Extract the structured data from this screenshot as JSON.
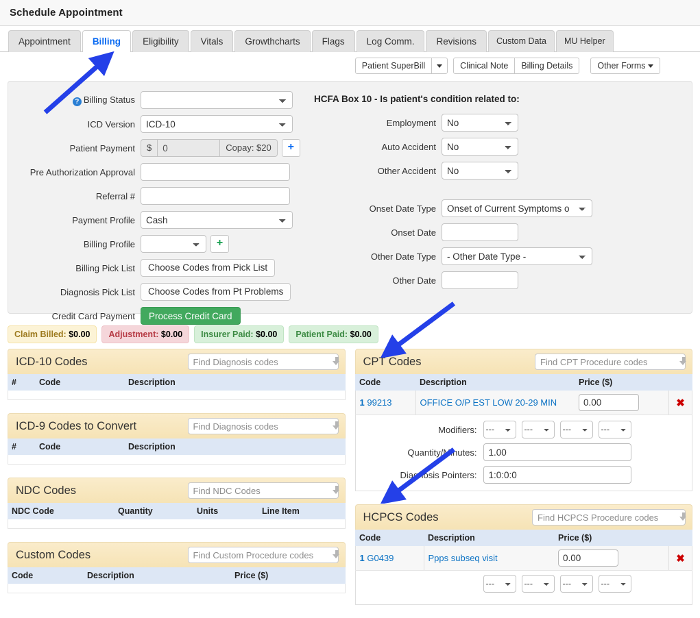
{
  "window": {
    "title": "Schedule Appointment"
  },
  "tabs": [
    {
      "label": "Appointment",
      "active": false
    },
    {
      "label": "Billing",
      "active": true
    },
    {
      "label": "Eligibility",
      "active": false
    },
    {
      "label": "Vitals",
      "active": false
    },
    {
      "label": "Growthcharts",
      "active": false
    },
    {
      "label": "Flags",
      "active": false
    },
    {
      "label": "Log Comm.",
      "active": false
    },
    {
      "label": "Revisions",
      "active": false
    },
    {
      "label": "Custom Data",
      "active": false
    },
    {
      "label": "MU Helper",
      "active": false
    }
  ],
  "actions": {
    "patient_superbill": "Patient SuperBill",
    "superbill_caret": "caret-down-icon",
    "clinical_note": "Clinical Note",
    "billing_details": "Billing Details",
    "other_forms": "Other Forms"
  },
  "billing_form": {
    "billing_status": {
      "label": "Billing Status",
      "help": "?",
      "value": ""
    },
    "icd_version": {
      "label": "ICD Version",
      "value": "ICD-10"
    },
    "patient_payment": {
      "label": "Patient Payment",
      "currency": "$",
      "value": "0",
      "copay": "Copay: $20",
      "add": "+"
    },
    "pre_auth": {
      "label": "Pre Authorization Approval",
      "value": ""
    },
    "referral": {
      "label": "Referral #",
      "value": ""
    },
    "payment_profile": {
      "label": "Payment Profile",
      "value": "Cash"
    },
    "billing_profile": {
      "label": "Billing Profile",
      "value": "",
      "add": "+"
    },
    "billing_pick_list": {
      "label": "Billing Pick List",
      "button": "Choose Codes from Pick List"
    },
    "diagnosis_pick_list": {
      "label": "Diagnosis Pick List",
      "button": "Choose Codes from Pt Problems"
    },
    "credit_card": {
      "label": "Credit Card Payment",
      "button": "Process Credit Card"
    }
  },
  "hcfa": {
    "heading": "HCFA Box 10 - Is patient's condition related to:",
    "employment": {
      "label": "Employment",
      "value": "No"
    },
    "auto_accident": {
      "label": "Auto Accident",
      "value": "No"
    },
    "other_accident": {
      "label": "Other Accident",
      "value": "No"
    },
    "onset_date_type": {
      "label": "Onset Date Type",
      "value": "Onset of Current Symptoms o"
    },
    "onset_date": {
      "label": "Onset Date",
      "value": ""
    },
    "other_date_type": {
      "label": "Other Date Type",
      "value": "- Other Date Type -"
    },
    "other_date": {
      "label": "Other Date",
      "value": ""
    }
  },
  "badges": [
    {
      "label": "Claim Billed:",
      "amount": "$0.00",
      "style": "warn"
    },
    {
      "label": "Adjustment:",
      "amount": "$0.00",
      "style": "danger"
    },
    {
      "label": "Insurer Paid:",
      "amount": "$0.00",
      "style": "ok"
    },
    {
      "label": "Patient Paid:",
      "amount": "$0.00",
      "style": "ok"
    }
  ],
  "panels": {
    "icd10": {
      "title": "ICD-10 Codes",
      "search_placeholder": "Find Diagnosis codes",
      "columns": [
        "#",
        "Code",
        "Description"
      ],
      "rows": []
    },
    "icd9": {
      "title": "ICD-9 Codes to Convert",
      "search_placeholder": "Find Diagnosis codes",
      "columns": [
        "#",
        "Code",
        "Description"
      ],
      "rows": []
    },
    "ndc": {
      "title": "NDC Codes",
      "search_placeholder": "Find NDC Codes",
      "columns": [
        "NDC Code",
        "Quantity",
        "Units",
        "Line Item"
      ],
      "rows": []
    },
    "custom": {
      "title": "Custom Codes",
      "search_placeholder": "Find Custom Procedure codes",
      "columns": [
        "Code",
        "Description",
        "Price ($)"
      ],
      "rows": []
    },
    "cpt": {
      "title": "CPT Codes",
      "search_placeholder": "Find CPT Procedure codes",
      "columns": [
        "Code",
        "Description",
        "Price ($)"
      ],
      "row": {
        "num": "1",
        "code": "99213",
        "description": "OFFICE O/P EST LOW 20-29 MIN",
        "price": "0.00",
        "delete": "✖"
      },
      "detail": {
        "modifiers_label": "Modifiers:",
        "modifiers": [
          "---",
          "---",
          "---",
          "---"
        ],
        "quantity_label": "Quantity/Minutes:",
        "quantity": "1.00",
        "pointers_label": "Diagnosis Pointers:",
        "pointers": "1:0:0:0"
      }
    },
    "hcpcs": {
      "title": "HCPCS Codes",
      "search_placeholder": "Find HCPCS Procedure codes",
      "columns": [
        "Code",
        "Description",
        "Price ($)"
      ],
      "row": {
        "num": "1",
        "code": "G0439",
        "description": "Ppps subseq visit",
        "price": "0.00",
        "delete": "✖"
      },
      "detail": {
        "modifiers": [
          "---",
          "---",
          "---",
          "---"
        ]
      }
    }
  },
  "annotations": {
    "color": "#2440e8",
    "arrows": [
      {
        "name": "arrow-to-billing-tab",
        "target": "Billing tab"
      },
      {
        "name": "arrow-to-cpt-codes",
        "target": "CPT Codes"
      },
      {
        "name": "arrow-to-hcpcs-codes",
        "target": "HCPCS Codes"
      }
    ]
  }
}
